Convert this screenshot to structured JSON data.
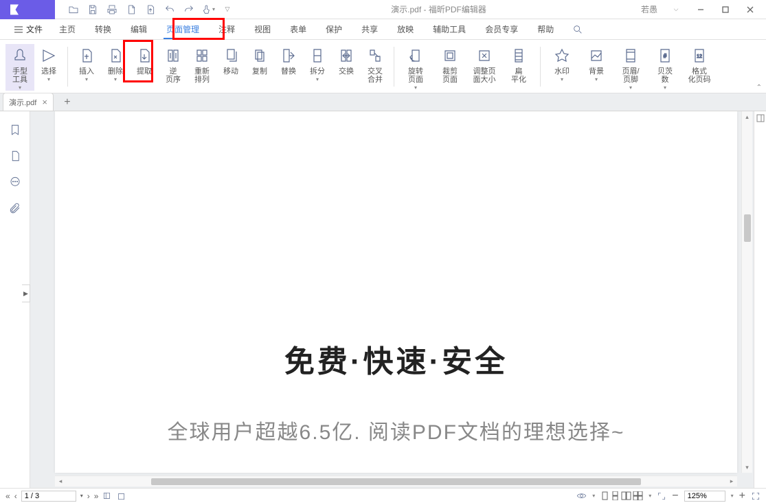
{
  "title": "演示.pdf - 福昕PDF编辑器",
  "user": "若愚",
  "menu": {
    "file": "文件",
    "items": [
      "主页",
      "转换",
      "编辑",
      "页面管理",
      "注释",
      "视图",
      "表单",
      "保护",
      "共享",
      "放映",
      "辅助工具",
      "会员专享",
      "帮助"
    ],
    "active_index": 3
  },
  "ribbon": {
    "items": [
      {
        "label": "手型\n工具",
        "drop": true
      },
      {
        "label": "选择",
        "drop": true
      },
      {
        "label": "插入",
        "drop": true
      },
      {
        "label": "删除",
        "drop": true
      },
      {
        "label": "提取"
      },
      {
        "label": "逆\n页序"
      },
      {
        "label": "重新\n排列"
      },
      {
        "label": "移动"
      },
      {
        "label": "复制"
      },
      {
        "label": "替换"
      },
      {
        "label": "拆分",
        "drop": true
      },
      {
        "label": "交换"
      },
      {
        "label": "交叉\n合并"
      },
      {
        "label": "旋转\n页面",
        "drop": true
      },
      {
        "label": "裁剪\n页面"
      },
      {
        "label": "调整页\n面大小"
      },
      {
        "label": "扁\n平化"
      },
      {
        "label": "水印",
        "drop": true
      },
      {
        "label": "背景",
        "drop": true
      },
      {
        "label": "页眉/\n页脚",
        "drop": true
      },
      {
        "label": "贝茨\n数",
        "drop": true
      },
      {
        "label": "格式\n化页码"
      }
    ]
  },
  "tab": {
    "name": "演示.pdf"
  },
  "page": {
    "heading": "免费·快速·安全",
    "subheading": "全球用户超越6.5亿. 阅读PDF文档的理想选择~"
  },
  "status": {
    "page": "1 / 3",
    "zoom": "125%"
  }
}
